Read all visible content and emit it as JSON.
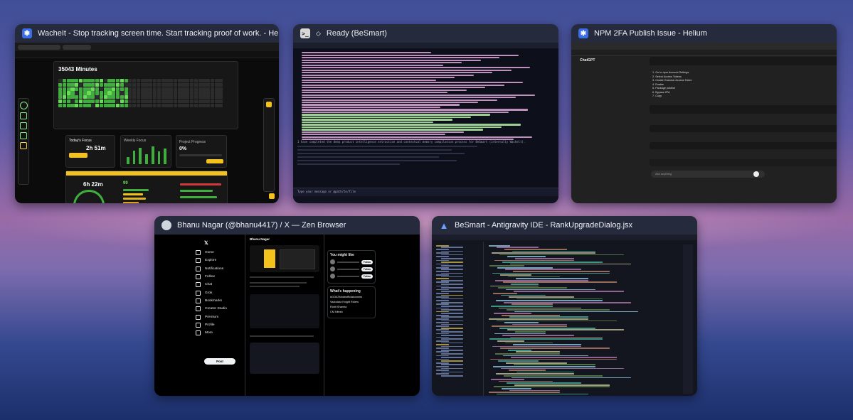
{
  "desktop": {
    "accent": "#3b6de6"
  },
  "windows": [
    {
      "title": "WacheIt - Stop tracking screen time. Start tracking proof of work. - Helium",
      "icon": "helium-icon",
      "content": {
        "minutes_total": "35043 Minutes",
        "todays_focus_label": "Today's Focus",
        "todays_focus_value": "2h 51m",
        "weekly_focus_label": "Weekly Focus",
        "project_progress_label": "Project Progress",
        "project_progress_value": "0%",
        "second_timer": "6h 22m",
        "stat_value": "99"
      }
    },
    {
      "title": "Ready (BeSmart)",
      "icon": "terminal-icon",
      "content": {
        "summary_line": "I have completed the deep product intelligence extraction and contextual memory compilation process for BeSmart (internally Wachelt).",
        "prompt": "Type your message or @path/to/file"
      }
    },
    {
      "title": "NPM 2FA Publish Issue - Helium",
      "icon": "helium-icon",
      "content": {
        "app_name": "ChatGPT",
        "input_placeholder": "Ask anything",
        "list_items": [
          "Go to npm Account Settings",
          "Select Access Tokens",
          "Create Granular Access Token",
          "Enable",
          "Package publish",
          "Bypass 2FA",
          "Copy"
        ]
      }
    },
    {
      "title": "Bhanu Nagar (@bhanu4417) / X — Zen Browser",
      "icon": "zen-icon",
      "content": {
        "nav": [
          "Home",
          "Explore",
          "Notifications",
          "Follow",
          "Chat",
          "Grok",
          "Bookmarks",
          "Creator Studio",
          "Premium",
          "Profile",
          "More"
        ],
        "post_button": "Post",
        "profile_name": "Bhanu Nagar",
        "you_might_like": "You might like",
        "whats_happening": "What's happening",
        "trends": [
          "#GOATModeofficialcomms",
          "Vadodara Knight Riders",
          "Rohit Sharma",
          "CM Nitesh"
        ],
        "follow_label": "Follow"
      }
    },
    {
      "title": "BeSmart - Antigravity IDE - RankUpgradeDialog.jsx",
      "icon": "antigravity-icon",
      "content": {
        "file": "RankUpgradeDialog.jsx"
      }
    }
  ]
}
